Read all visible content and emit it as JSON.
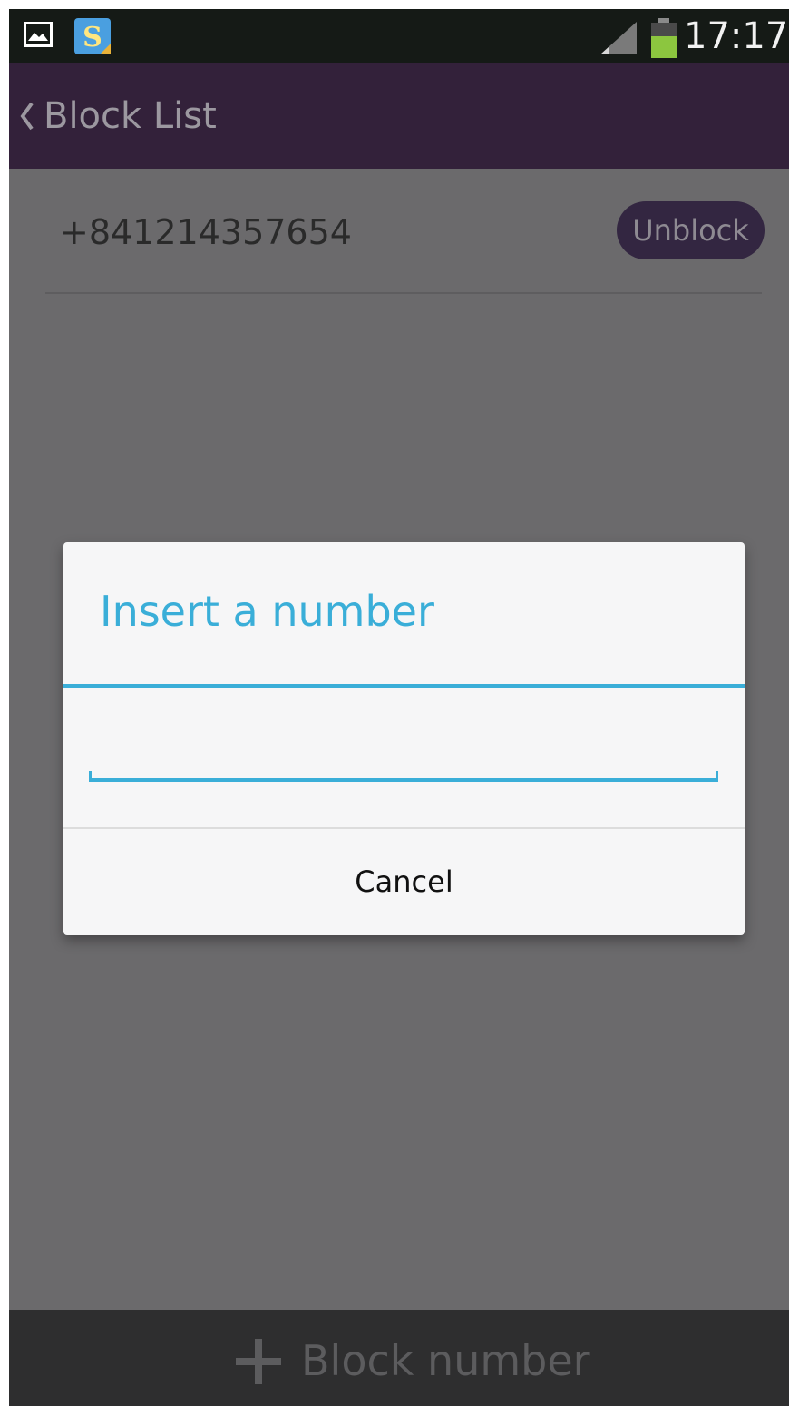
{
  "status_bar": {
    "time": "17:17",
    "icons": [
      "gallery-icon",
      "s-app-icon",
      "signal-icon",
      "battery-icon"
    ],
    "app_icon_letter": "S"
  },
  "app_bar": {
    "title": "Block List",
    "back_icon": "chevron-left-icon",
    "background": "#33213a"
  },
  "blocked_list": {
    "items": [
      {
        "number": "+841214357654",
        "action_label": "Unblock"
      }
    ]
  },
  "dialog": {
    "title": "Insert a number",
    "input": {
      "value": "",
      "placeholder": ""
    },
    "cancel_label": "Cancel",
    "accent_color": "#3aaed8"
  },
  "bottom_bar": {
    "icon": "plus-icon",
    "label": "Block number"
  }
}
